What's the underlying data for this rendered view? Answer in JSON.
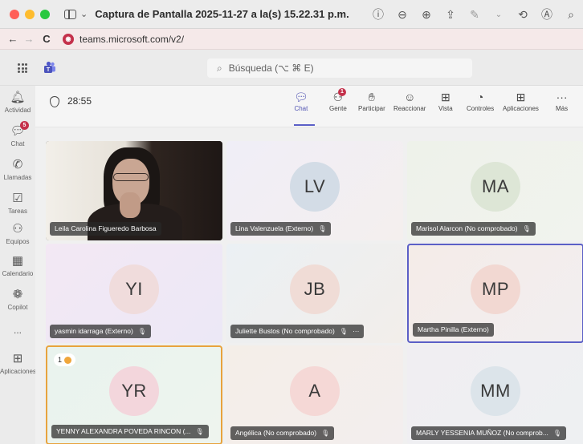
{
  "window": {
    "title": "Captura de Pantalla 2025-11-27 a la(s) 15.22.31 p.m."
  },
  "browser": {
    "url": "teams.microsoft.com/v2/"
  },
  "search": {
    "placeholder": "Búsqueda (⌥ ⌘ E)"
  },
  "rail": {
    "items": [
      {
        "label": "Actividad",
        "icon": "bell-icon"
      },
      {
        "label": "Chat",
        "icon": "chat-icon",
        "badge": "5"
      },
      {
        "label": "Llamadas",
        "icon": "phone-icon"
      },
      {
        "label": "Tareas",
        "icon": "tasks-icon"
      },
      {
        "label": "Equipos",
        "icon": "teams-icon"
      },
      {
        "label": "Calendario",
        "icon": "calendar-icon"
      },
      {
        "label": "Copilot",
        "icon": "copilot-icon"
      },
      {
        "label": "...",
        "icon": "more-icon"
      },
      {
        "label": "Aplicaciones",
        "icon": "apps-icon"
      }
    ]
  },
  "meeting": {
    "timer": "28:55",
    "toolbar": [
      {
        "label": "Chat",
        "icon": "chat-icon"
      },
      {
        "label": "Gente",
        "icon": "people-icon",
        "badge": "1"
      },
      {
        "label": "Participar",
        "icon": "raise-hand-icon"
      },
      {
        "label": "Reaccionar",
        "icon": "emoji-icon"
      },
      {
        "label": "Vista",
        "icon": "view-icon"
      },
      {
        "label": "Controles",
        "icon": "controls-icon"
      },
      {
        "label": "Aplicaciones",
        "icon": "add-apps-icon"
      },
      {
        "label": "Más",
        "icon": "more-icon"
      }
    ]
  },
  "participants": [
    {
      "name": "Leila Carolina Figueredo Barbosa",
      "initials": "",
      "video": true,
      "muted": false
    },
    {
      "name": "Lina Valenzuela (Externo)",
      "initials": "LV",
      "video": false,
      "muted": true
    },
    {
      "name": "Marisol Alarcon (No comprobado)",
      "initials": "MA",
      "video": false,
      "muted": true
    },
    {
      "name": "yasmin idarraga (Externo)",
      "initials": "YI",
      "video": false,
      "muted": true
    },
    {
      "name": "Juliette Bustos (No comprobado)",
      "initials": "JB",
      "video": false,
      "muted": true,
      "extra": "···"
    },
    {
      "name": "Martha Pinilla (Externo)",
      "initials": "MP",
      "video": false,
      "muted": false
    },
    {
      "name": "YENNY ALEXANDRA POVEDA RINCON (...",
      "initials": "YR",
      "video": false,
      "muted": true,
      "hand_raised": "1"
    },
    {
      "name": "Angélica (No comprobado)",
      "initials": "A",
      "video": false,
      "muted": true
    },
    {
      "name": "MARLY YESSENIA MUÑOZ (No comprob...",
      "initials": "MM",
      "video": false,
      "muted": true
    }
  ],
  "colors": {
    "accent": "#5b5fc7",
    "badge": "#c4314b",
    "active_speaker": "#e8a33d"
  }
}
